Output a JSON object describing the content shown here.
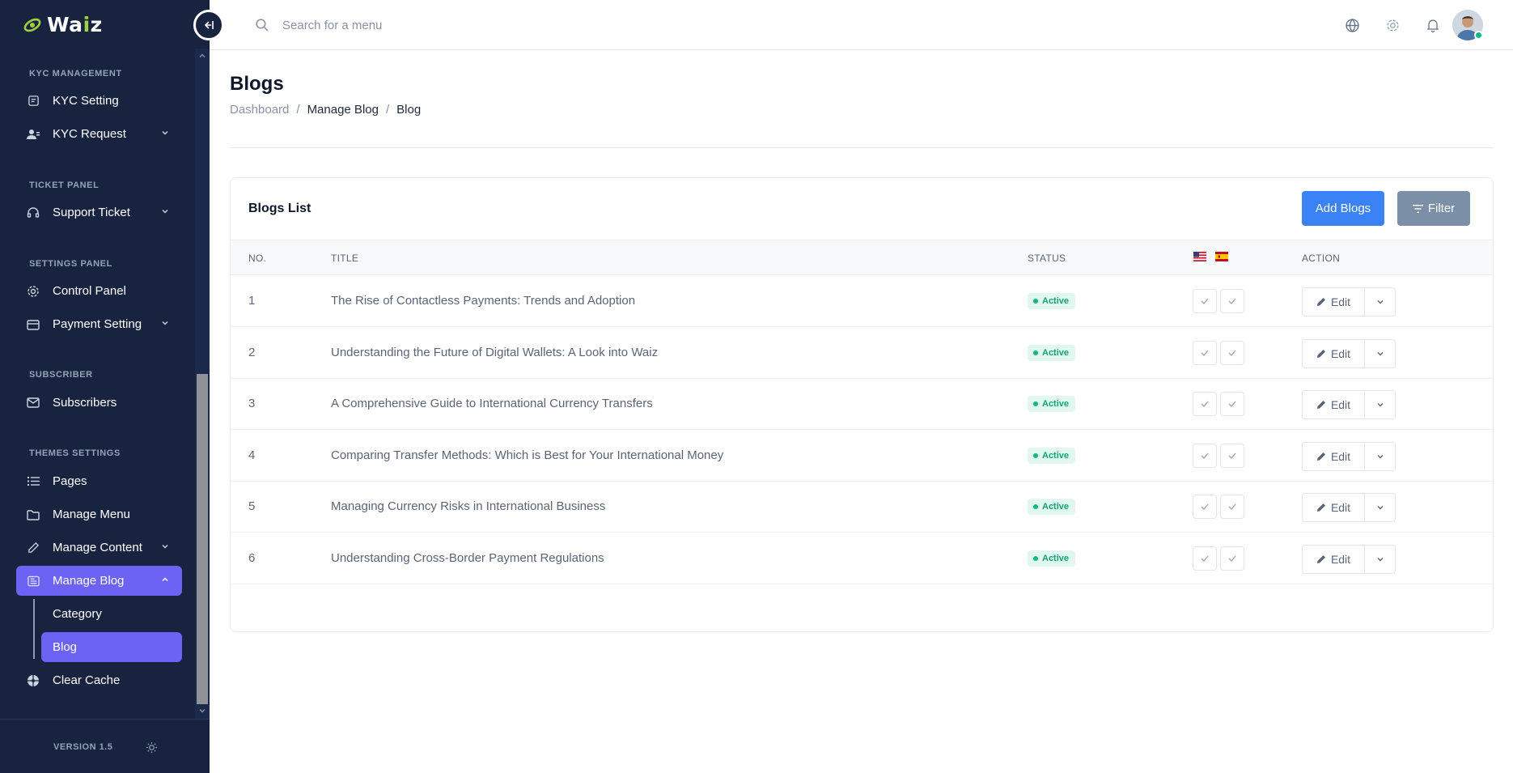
{
  "app": {
    "logo_main": "Wa",
    "logo_accent": "i",
    "logo_end": "z"
  },
  "sidebar": {
    "sections": [
      {
        "title": "KYC MANAGEMENT",
        "items": [
          {
            "label": "KYC Setting",
            "icon": "kyc-setting-icon"
          },
          {
            "label": "KYC Request",
            "icon": "users-icon",
            "has_submenu": true
          }
        ]
      },
      {
        "title": "TICKET PANEL",
        "items": [
          {
            "label": "Support Ticket",
            "icon": "headset-icon",
            "has_submenu": true
          }
        ]
      },
      {
        "title": "SETTINGS PANEL",
        "items": [
          {
            "label": "Control Panel",
            "icon": "gear-icon"
          },
          {
            "label": "Payment Setting",
            "icon": "wallet-icon",
            "has_submenu": true
          }
        ]
      },
      {
        "title": "SUBSCRIBER",
        "items": [
          {
            "label": "Subscribers",
            "icon": "mail-icon"
          }
        ]
      },
      {
        "title": "THEMES SETTINGS",
        "items": [
          {
            "label": "Pages",
            "icon": "list-icon"
          },
          {
            "label": "Manage Menu",
            "icon": "folder-icon"
          },
          {
            "label": "Manage Content",
            "icon": "pencil-icon",
            "has_submenu": true
          },
          {
            "label": "Manage Blog",
            "icon": "blog-icon",
            "active": true,
            "expanded": true,
            "children": [
              {
                "label": "Category"
              },
              {
                "label": "Blog",
                "active": true
              }
            ]
          },
          {
            "label": "Clear Cache",
            "icon": "cache-icon"
          }
        ]
      }
    ],
    "version": "VERSION 1.5"
  },
  "topbar": {
    "search_placeholder": "Search for a menu"
  },
  "page": {
    "title": "Blogs",
    "breadcrumb": [
      "Dashboard",
      "Manage Blog",
      "Blog"
    ]
  },
  "card": {
    "title": "Blogs List",
    "add_button": "Add Blogs",
    "filter_button": "Filter",
    "columns": [
      "NO.",
      "TITLE",
      "STATUS",
      "ACTION"
    ],
    "language_flags": [
      "us-flag-icon",
      "es-flag-icon"
    ],
    "rows": [
      {
        "no": "1",
        "title": "The Rise of Contactless Payments: Trends and Adoption",
        "status": "Active",
        "action": "Edit"
      },
      {
        "no": "2",
        "title": "Understanding the Future of Digital Wallets: A Look into Waiz",
        "status": "Active",
        "action": "Edit"
      },
      {
        "no": "3",
        "title": "A Comprehensive Guide to International Currency Transfers",
        "status": "Active",
        "action": "Edit"
      },
      {
        "no": "4",
        "title": "Comparing Transfer Methods: Which is Best for Your International Money",
        "status": "Active",
        "action": "Edit"
      },
      {
        "no": "5",
        "title": "Managing Currency Risks in International Business",
        "status": "Active",
        "action": "Edit"
      },
      {
        "no": "6",
        "title": "Understanding Cross-Border Payment Regulations",
        "status": "Active",
        "action": "Edit"
      }
    ]
  },
  "colors": {
    "sidebar_bg": "#17233f",
    "accent": "#6c63f5",
    "primary": "#3b82f6",
    "success": "#10b981",
    "logo_accent": "#a3d13d"
  }
}
